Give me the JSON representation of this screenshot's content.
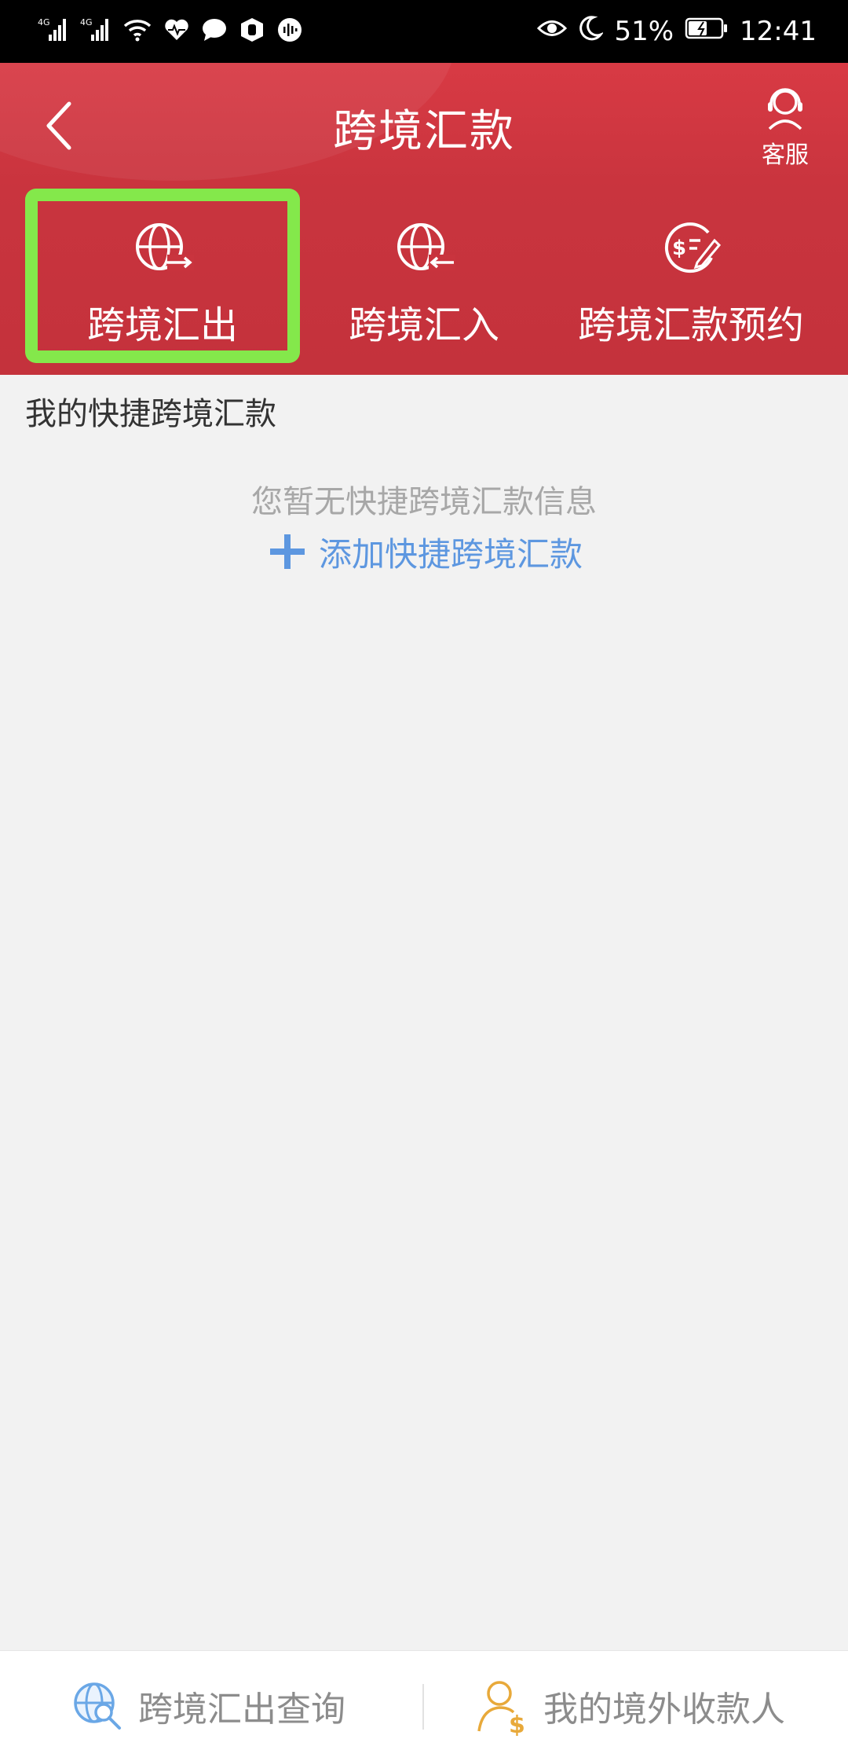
{
  "status_bar": {
    "network_1": "4G",
    "network_2": "4G",
    "battery": "51%",
    "time": "12:41"
  },
  "header": {
    "title": "跨境汇款",
    "service_label": "客服"
  },
  "tabs": [
    {
      "label": "跨境汇出",
      "icon": "globe-outbound-icon",
      "selected": true
    },
    {
      "label": "跨境汇入",
      "icon": "globe-inbound-icon",
      "selected": false
    },
    {
      "label": "跨境汇款预约",
      "icon": "dollar-edit-icon",
      "selected": false
    }
  ],
  "quick": {
    "title": "我的快捷跨境汇款",
    "empty_message": "您暂无快捷跨境汇款信息",
    "add_label": "添加快捷跨境汇款"
  },
  "bottom_bar": {
    "query_label": "跨境汇出查询",
    "payee_label": "我的境外收款人"
  },
  "colors": {
    "header_red": "#c9343e",
    "highlight_green": "#84e84b",
    "link_blue": "#5d97e0",
    "payee_icon_gold": "#e8a93a",
    "query_icon_blue": "#6aa7e6"
  }
}
